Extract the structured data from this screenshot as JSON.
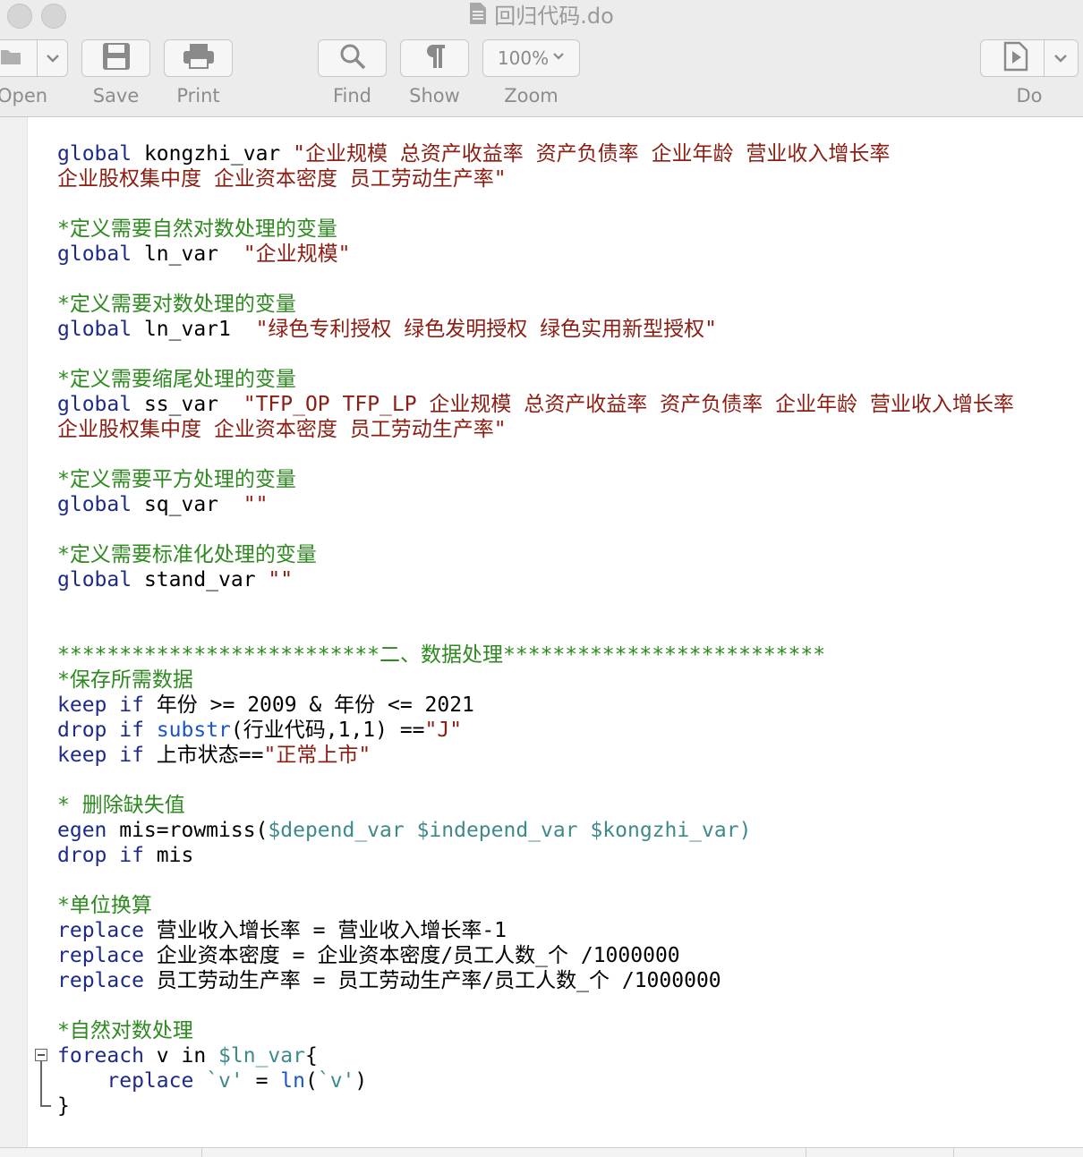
{
  "window": {
    "title": "回归代码.do"
  },
  "toolbar": {
    "open_label": "Open",
    "save_label": "Save",
    "print_label": "Print",
    "find_label": "Find",
    "show_label": "Show",
    "zoom_value": "100%",
    "zoom_label": "Zoom",
    "do_label": "Do"
  },
  "code": {
    "lines": [
      [
        {
          "c": "kw",
          "t": "global"
        },
        {
          "c": "",
          "t": " kongzhi_var "
        },
        {
          "c": "str",
          "t": "\"企业规模 总资产收益率 资产负债率 企业年龄 营业收入增长率"
        }
      ],
      [
        {
          "c": "str",
          "t": "企业股权集中度 企业资本密度 员工劳动生产率\""
        }
      ],
      [],
      [
        {
          "c": "cm",
          "t": "*定义需要自然对数处理的变量"
        }
      ],
      [
        {
          "c": "kw",
          "t": "global"
        },
        {
          "c": "",
          "t": " ln_var  "
        },
        {
          "c": "str",
          "t": "\"企业规模\""
        }
      ],
      [],
      [
        {
          "c": "cm",
          "t": "*定义需要对数处理的变量"
        }
      ],
      [
        {
          "c": "kw",
          "t": "global"
        },
        {
          "c": "",
          "t": " ln_var1  "
        },
        {
          "c": "str",
          "t": "\"绿色专利授权 绿色发明授权 绿色实用新型授权\""
        }
      ],
      [],
      [
        {
          "c": "cm",
          "t": "*定义需要缩尾处理的变量"
        }
      ],
      [
        {
          "c": "kw",
          "t": "global"
        },
        {
          "c": "",
          "t": " ss_var  "
        },
        {
          "c": "str",
          "t": "\"TFP_OP TFP_LP 企业规模 总资产收益率 资产负债率 企业年龄 营业收入增长率"
        }
      ],
      [
        {
          "c": "str",
          "t": "企业股权集中度 企业资本密度 员工劳动生产率\""
        }
      ],
      [],
      [
        {
          "c": "cm",
          "t": "*定义需要平方处理的变量"
        }
      ],
      [
        {
          "c": "kw",
          "t": "global"
        },
        {
          "c": "",
          "t": " sq_var  "
        },
        {
          "c": "str",
          "t": "\"\""
        }
      ],
      [],
      [
        {
          "c": "cm",
          "t": "*定义需要标准化处理的变量"
        }
      ],
      [
        {
          "c": "kw",
          "t": "global"
        },
        {
          "c": "",
          "t": " stand_var "
        },
        {
          "c": "str",
          "t": "\"\""
        }
      ],
      [],
      [],
      [
        {
          "c": "cm",
          "t": "**************************二、数据处理**************************"
        }
      ],
      [
        {
          "c": "cm",
          "t": "*保存所需数据"
        }
      ],
      [
        {
          "c": "kw",
          "t": "keep"
        },
        {
          "c": "",
          "t": " "
        },
        {
          "c": "kw",
          "t": "if"
        },
        {
          "c": "",
          "t": " 年份 >= 2009 & 年份 <= 2021"
        }
      ],
      [
        {
          "c": "kw",
          "t": "drop"
        },
        {
          "c": "",
          "t": " "
        },
        {
          "c": "kw",
          "t": "if"
        },
        {
          "c": "",
          "t": " "
        },
        {
          "c": "fn",
          "t": "substr"
        },
        {
          "c": "",
          "t": "(行业代码,1,1) =="
        },
        {
          "c": "str",
          "t": "\"J\""
        }
      ],
      [
        {
          "c": "kw",
          "t": "keep"
        },
        {
          "c": "",
          "t": " "
        },
        {
          "c": "kw",
          "t": "if"
        },
        {
          "c": "",
          "t": " 上市状态=="
        },
        {
          "c": "str",
          "t": "\"正常上市\""
        }
      ],
      [],
      [
        {
          "c": "cm",
          "t": "* 删除缺失值"
        }
      ],
      [
        {
          "c": "kw",
          "t": "egen"
        },
        {
          "c": "",
          "t": " mis=rowmiss("
        },
        {
          "c": "mac",
          "t": "$depend_var $independ_var $kongzhi_var)"
        }
      ],
      [
        {
          "c": "kw",
          "t": "drop"
        },
        {
          "c": "",
          "t": " "
        },
        {
          "c": "kw",
          "t": "if"
        },
        {
          "c": "",
          "t": " mis"
        }
      ],
      [],
      [
        {
          "c": "cm",
          "t": "*单位换算"
        }
      ],
      [
        {
          "c": "kw",
          "t": "replace"
        },
        {
          "c": "",
          "t": " 营业收入增长率 = 营业收入增长率-1"
        }
      ],
      [
        {
          "c": "kw",
          "t": "replace"
        },
        {
          "c": "",
          "t": " 企业资本密度 = 企业资本密度/员工人数_个 /1000000"
        }
      ],
      [
        {
          "c": "kw",
          "t": "replace"
        },
        {
          "c": "",
          "t": " 员工劳动生产率 = 员工劳动生产率/员工人数_个 /1000000"
        }
      ],
      [],
      [
        {
          "c": "cm",
          "t": "*自然对数处理"
        }
      ],
      [
        {
          "c": "kw",
          "t": "foreach"
        },
        {
          "c": "",
          "t": " v in "
        },
        {
          "c": "mac",
          "t": "$ln_var"
        },
        {
          "c": "",
          "t": "{"
        }
      ],
      [
        {
          "c": "",
          "t": "    "
        },
        {
          "c": "kw",
          "t": "replace"
        },
        {
          "c": "",
          "t": " "
        },
        {
          "c": "mac",
          "t": "`v'"
        },
        {
          "c": "",
          "t": " = "
        },
        {
          "c": "fn",
          "t": "ln"
        },
        {
          "c": "",
          "t": "("
        },
        {
          "c": "mac",
          "t": "`v'"
        },
        {
          "c": "",
          "t": ")"
        }
      ],
      [
        {
          "c": "",
          "t": "}"
        }
      ]
    ]
  }
}
